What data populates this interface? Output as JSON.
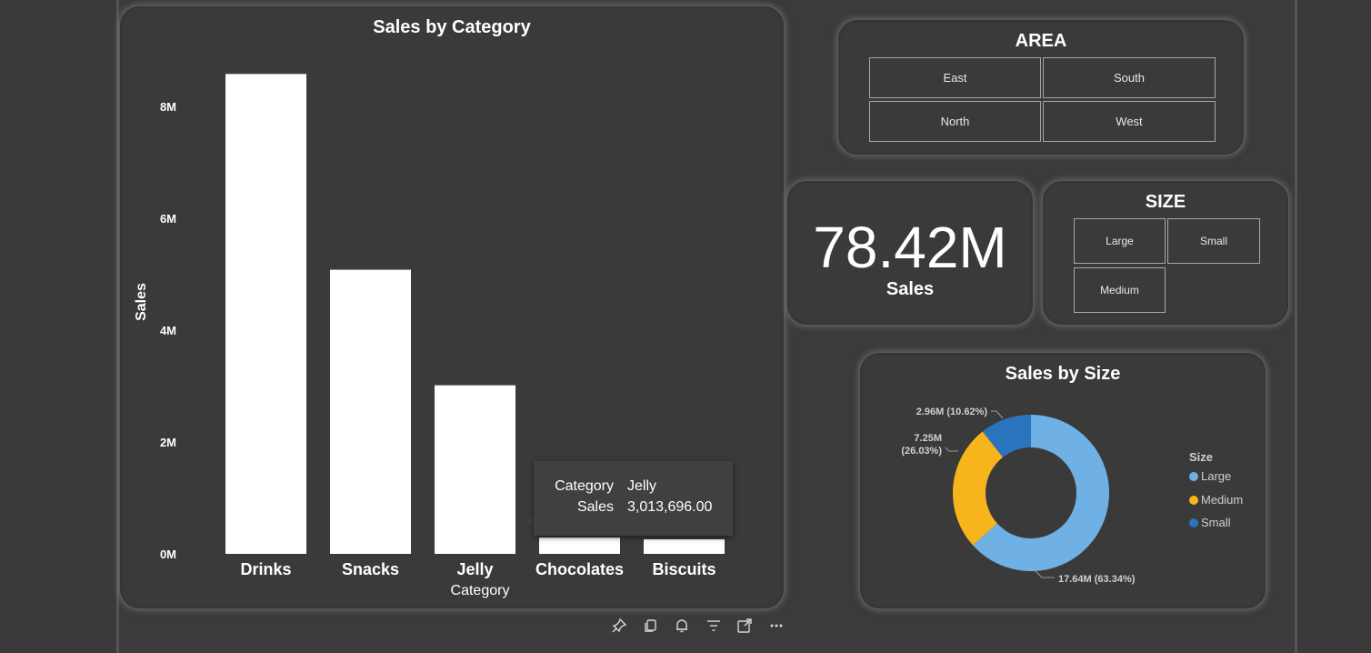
{
  "bar_card": {
    "title": "Sales by Category"
  },
  "area_slicer": {
    "title": "AREA",
    "options": [
      "East",
      "South",
      "North",
      "West"
    ]
  },
  "kpi": {
    "value": "78.42M",
    "label": "Sales"
  },
  "size_slicer": {
    "title": "SIZE",
    "options": [
      "Large",
      "Small",
      "Medium"
    ]
  },
  "donut_card": {
    "title": "Sales by Size"
  },
  "tooltip": {
    "rows": [
      {
        "key": "Category",
        "value": "Jelly"
      },
      {
        "key": "Sales",
        "value": "3,013,696.00"
      }
    ]
  },
  "visual_toolbar": {
    "icons": [
      "pin-icon",
      "copy-icon",
      "bell-icon",
      "filter-icon",
      "focus-mode-icon",
      "more-options-icon"
    ]
  },
  "colors": {
    "bar": "#ffffff",
    "large": "#6fb1e4",
    "medium": "#f8b41c",
    "small": "#2a74bd"
  },
  "chart_data": [
    {
      "type": "bar",
      "title": "Sales by Category",
      "xlabel": "Category",
      "ylabel": "Sales",
      "categories": [
        "Drinks",
        "Snacks",
        "Jelly",
        "Chocolates",
        "Biscuits"
      ],
      "values": [
        8580000,
        5080000,
        3013696,
        290000,
        260000
      ],
      "ylim": [
        0,
        8000000
      ],
      "yticks": [
        {
          "value": 0,
          "label": "0M"
        },
        {
          "value": 2000000,
          "label": "2M"
        },
        {
          "value": 4000000,
          "label": "4M"
        },
        {
          "value": 6000000,
          "label": "6M"
        },
        {
          "value": 8000000,
          "label": "8M"
        }
      ],
      "grid": false
    },
    {
      "type": "pie",
      "title": "Sales by Size",
      "donut": true,
      "legend_title": "Size",
      "legend_position": "right",
      "slices": [
        {
          "name": "Large",
          "value": 17.64,
          "label": "17.64M (63.34%)"
        },
        {
          "name": "Medium",
          "value": 7.25,
          "label": "7.25M (26.03%)"
        },
        {
          "name": "Small",
          "value": 2.96,
          "label": "2.96M (10.62%)"
        }
      ]
    }
  ]
}
